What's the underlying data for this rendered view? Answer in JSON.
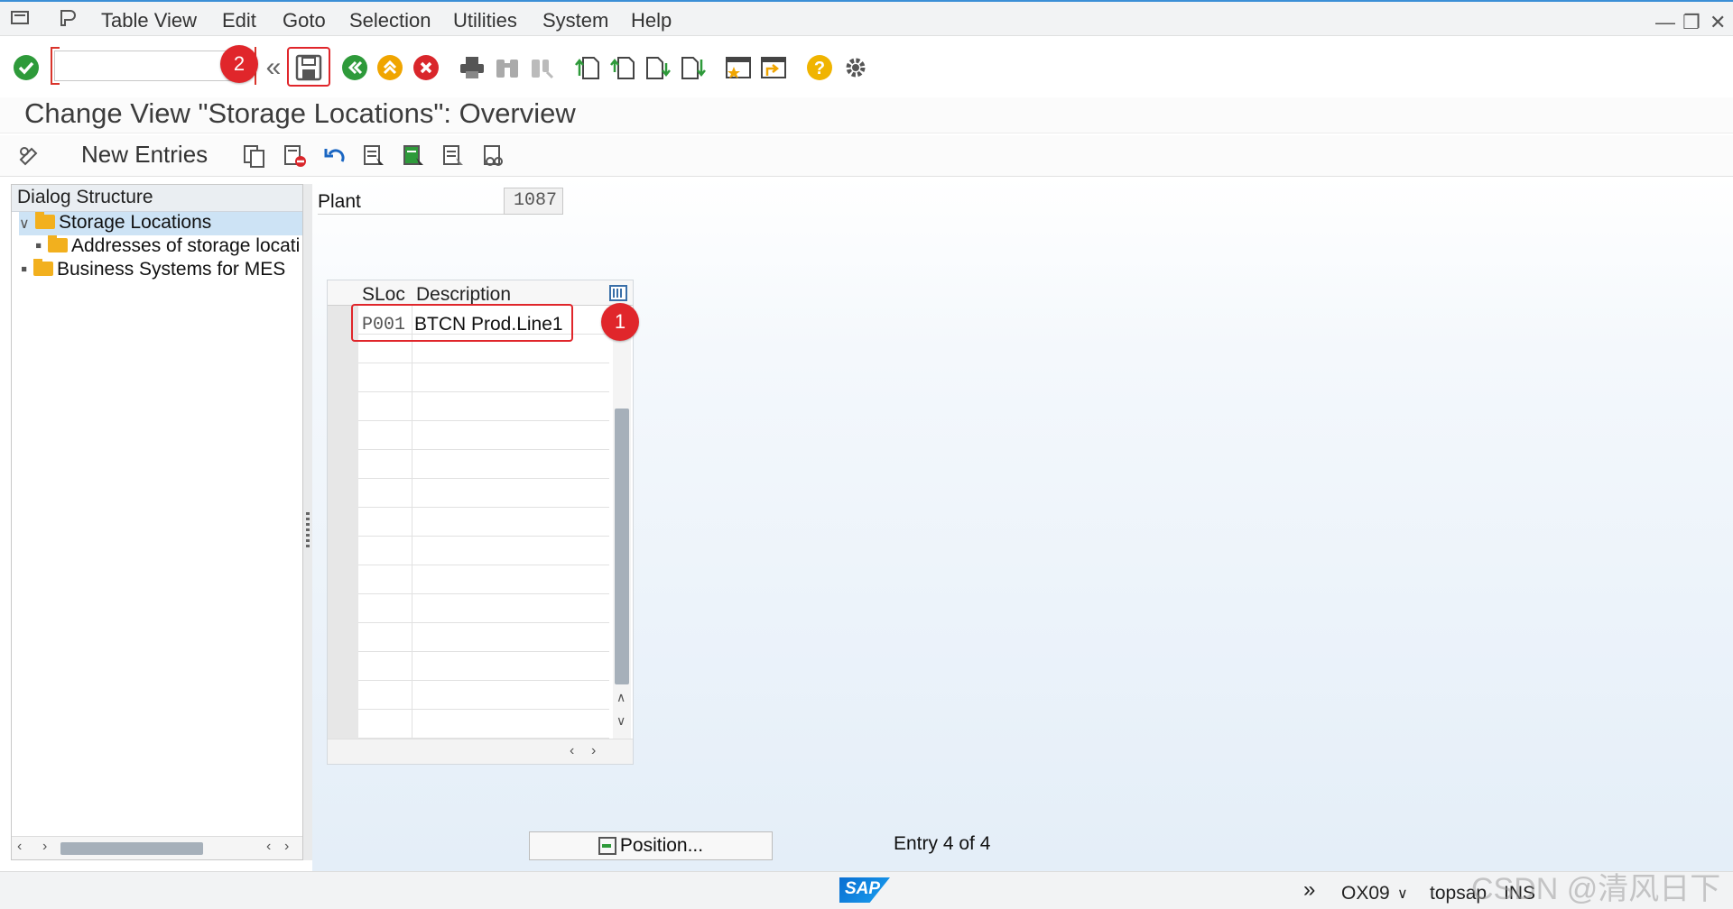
{
  "menubar": {
    "items": [
      "Table View",
      "Edit",
      "Goto",
      "Selection",
      "Utilities",
      "System",
      "Help"
    ]
  },
  "toolbar": {
    "command_value": "",
    "badge_2": "2",
    "badge_1": "1"
  },
  "title": "Change View \"Storage Locations\": Overview",
  "app_toolbar": {
    "new_entries": "New Entries"
  },
  "dialog_structure": {
    "header": "Dialog Structure",
    "items": [
      {
        "label": "Storage Locations",
        "selected": true
      },
      {
        "label": "Addresses of storage locati"
      },
      {
        "label": "Business Systems for MES"
      }
    ]
  },
  "plant": {
    "label": "Plant",
    "value": "1087"
  },
  "table": {
    "columns": [
      "SLoc",
      "Description"
    ],
    "rows": [
      {
        "sloc": "P001",
        "description": "BTCN Prod.Line1"
      }
    ]
  },
  "position_button": "Position...",
  "entry_info": "Entry 4 of 4",
  "statusbar": {
    "transaction": "OX09",
    "server": "topsap",
    "mode": "INS"
  },
  "watermark": "CSDN @清风日下",
  "colors": {
    "accent_red": "#e0262b",
    "selection_blue": "#cde3f5",
    "folder": "#f2b01e"
  }
}
